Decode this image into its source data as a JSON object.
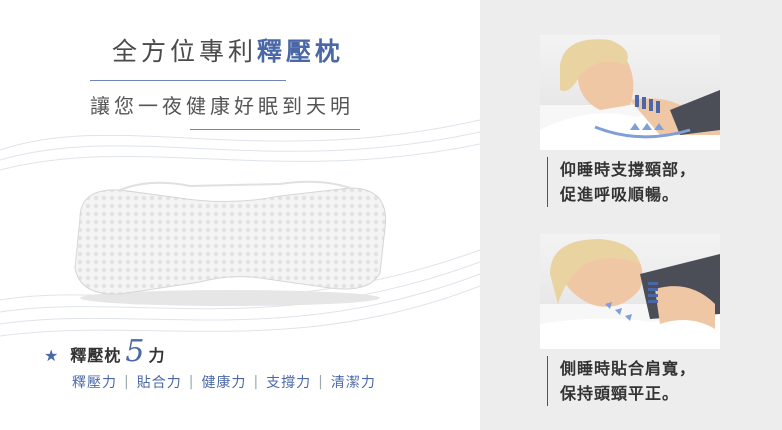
{
  "title": {
    "main": "全方位專利",
    "accent": "釋壓枕"
  },
  "subtitle": "讓您一夜健康好眠到天明",
  "power": {
    "label": "釋壓枕",
    "number": "5",
    "suffix": "力"
  },
  "features": [
    "釋壓力",
    "貼合力",
    "健康力",
    "支撐力",
    "清潔力"
  ],
  "captions": [
    {
      "line1": "仰睡時支撐頸部，",
      "line2": "促進呼吸順暢。"
    },
    {
      "line1": "側睡時貼合肩寬，",
      "line2": "保持頭頸平正。"
    }
  ],
  "colors": {
    "accent": "#4a68a8",
    "right_panel": "#ededed"
  },
  "icons": {
    "bullet": "star-icon"
  }
}
